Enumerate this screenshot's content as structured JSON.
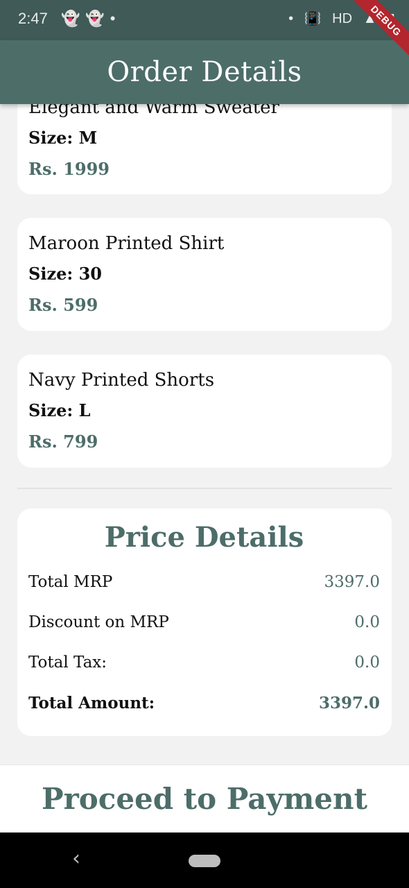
{
  "status_bar": {
    "time": "2:47",
    "left_icons": "👻👻•",
    "right_icons": [
      "•",
      "📳",
      "HD",
      "▲",
      "▮"
    ]
  },
  "app_bar": {
    "title": "Order Details",
    "debug_label": "DEBUG",
    "background_color": "#4d6d69"
  },
  "order_items": [
    {
      "name": "Elegant and Warm Sweater",
      "size": "Size: M",
      "price": "Rs. 1999"
    },
    {
      "name": "Maroon Printed Shirt",
      "size": "Size: 30",
      "price": "Rs. 599"
    },
    {
      "name": "Navy Printed Shorts",
      "size": "Size: L",
      "price": "Rs. 799"
    }
  ],
  "price_details": {
    "title": "Price Details",
    "rows": [
      {
        "label": "Total MRP",
        "value": "3397.0"
      },
      {
        "label": "Discount on MRP",
        "value": "0.0"
      },
      {
        "label": "Total Tax:",
        "value": "0.0"
      },
      {
        "label": "Total Amount:",
        "value": "3397.0"
      }
    ]
  },
  "footer": {
    "proceed_label": "Proceed to Payment"
  },
  "nav_bar": {
    "back_icon": "back-icon",
    "home_icon": "home-pill-icon"
  },
  "colors": {
    "accent": "#4d6d69",
    "status_bar": "#3f5a57",
    "background": "#f2f2f2",
    "card": "#ffffff"
  }
}
